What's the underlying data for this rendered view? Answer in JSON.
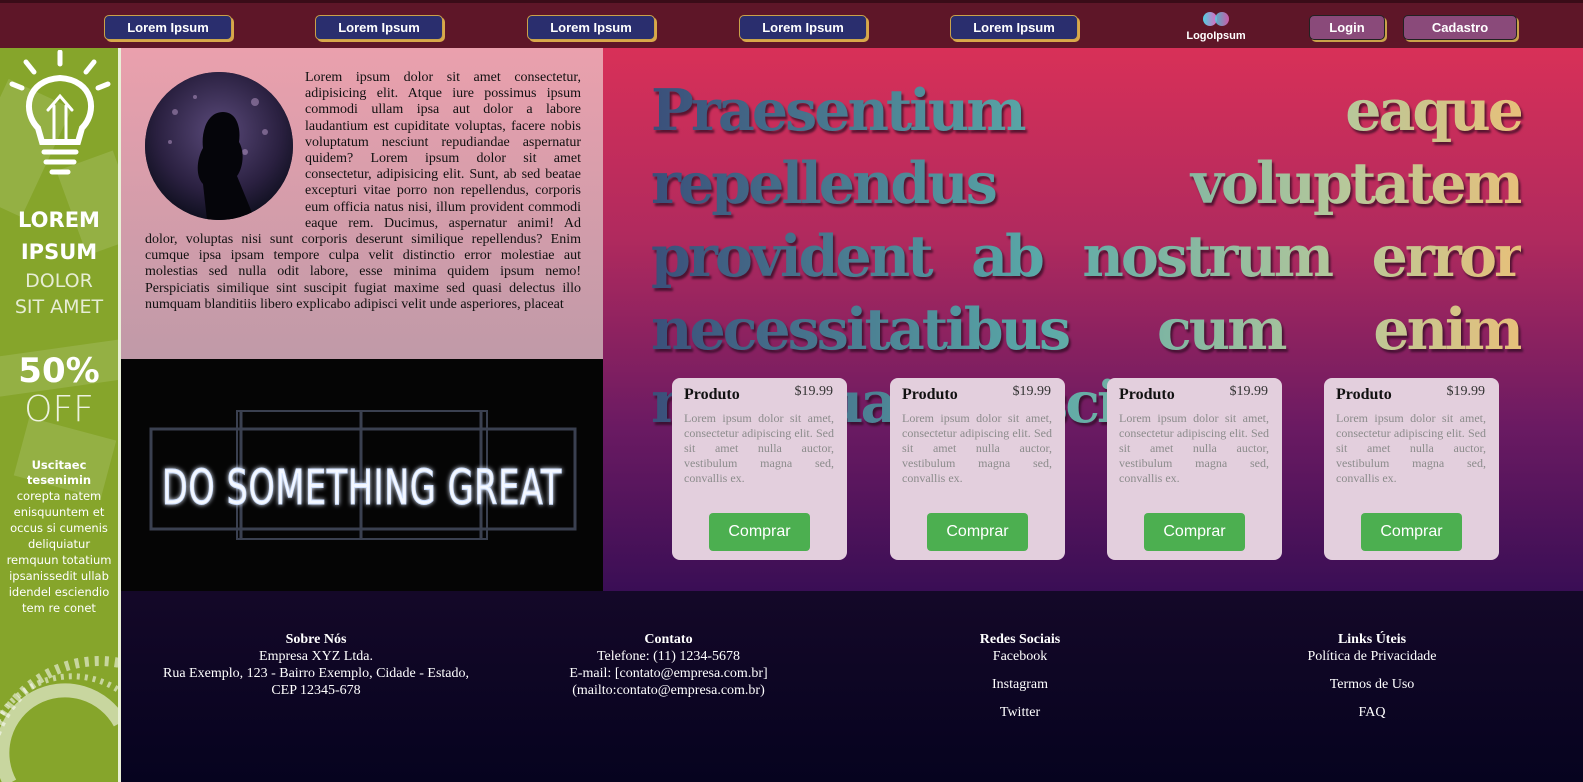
{
  "nav": {
    "links": [
      "Lorem Ipsum",
      "Lorem Ipsum",
      "Lorem Ipsum",
      "Lorem Ipsum",
      "Lorem Ipsum"
    ],
    "logo_text": "LogoIpsum",
    "login_label": "Login",
    "signup_label": "Cadastro"
  },
  "banner": {
    "line1": "LOREM",
    "line2": "IPSUM",
    "line3": "DOLOR",
    "line4": "SIT AMET",
    "discount": "50%",
    "off": "OFF",
    "bold_lines": [
      "Uscitaec",
      "tesenimin"
    ],
    "small_lines": [
      "corepta natem",
      "enisquuntem et",
      "occus si cumenis",
      "deliquiatur",
      "remquun totatium",
      "ipsanissedit ullab",
      "idendel esciendio",
      "tem re conet"
    ]
  },
  "intro": {
    "text": "Lorem ipsum dolor sit amet consectetur, adipisicing elit. Atque iure possimus ipsum commodi ullam ipsa aut dolor a labore laudantium est cupiditate voluptas, facere nobis voluptatum nesciunt repudiandae aspernatur quidem? Lorem ipsum dolor sit amet consectetur, adipisicing elit. Sunt, ab sed beatae excepturi vitae porro non repellendus, corporis eum officia natus nisi, illum provident commodi eaque rem. Ducimus, aspernatur animi! Ad dolor, voluptas nisi sunt corporis deserunt similique repellendus? Enim cumque ipsa ipsam tempore culpa velit distinctio error molestiae aut molestias sed nulla odit labore, esse minima quidem ipsum nemo! Perspiciatis similique sint suscipit fugiat maxime sed quasi delectus illo numquam blanditiis libero explicabo adipisci velit unde asperiores, placeat"
  },
  "neon_sign": "DO SOMETHING GREAT",
  "hero": {
    "title": "Praesentium eaque repellendus voluptatem provident ab nostrum error necessitatibus cum enim numquam suscipit"
  },
  "products": [
    {
      "name": "Produto",
      "price": "$19.99",
      "desc": "Lorem ipsum dolor sit amet, consectetur adipiscing elit. Sed sit amet nulla auctor, vestibulum magna sed, convallis ex.",
      "button": "Comprar"
    },
    {
      "name": "Produto",
      "price": "$19.99",
      "desc": "Lorem ipsum dolor sit amet, consectetur adipiscing elit. Sed sit amet nulla auctor, vestibulum magna sed, convallis ex.",
      "button": "Comprar"
    },
    {
      "name": "Produto",
      "price": "$19.99",
      "desc": "Lorem ipsum dolor sit amet, consectetur adipiscing elit. Sed sit amet nulla auctor, vestibulum magna sed, convallis ex.",
      "button": "Comprar"
    },
    {
      "name": "Produto",
      "price": "$19.99",
      "desc": "Lorem ipsum dolor sit amet, consectetur adipiscing elit. Sed sit amet nulla auctor, vestibulum magna sed, convallis ex.",
      "button": "Comprar"
    }
  ],
  "footer": {
    "about": {
      "title": "Sobre Nós",
      "company": "Empresa XYZ Ltda.",
      "address": "Rua Exemplo, 123 - Bairro Exemplo, Cidade - Estado, CEP 12345-678"
    },
    "contact": {
      "title": "Contato",
      "phone": "Telefone: (11) 1234-5678",
      "email": "E-mail: [contato@empresa.com.br]",
      "mailto": "(mailto:contato@empresa.com.br)"
    },
    "social": {
      "title": "Redes Sociais",
      "links": [
        "Facebook",
        "Instagram",
        "Twitter"
      ]
    },
    "useful": {
      "title": "Links Úteis",
      "links": [
        "Política de Privacidade",
        "Termos de Uso",
        "FAQ"
      ]
    }
  },
  "colors": {
    "topbar": "#5e1628",
    "nav_button": "#2a2e6e",
    "auth_button": "#8a4a7a",
    "banner_green": "#86a52b",
    "buy_button": "#4caf50"
  }
}
